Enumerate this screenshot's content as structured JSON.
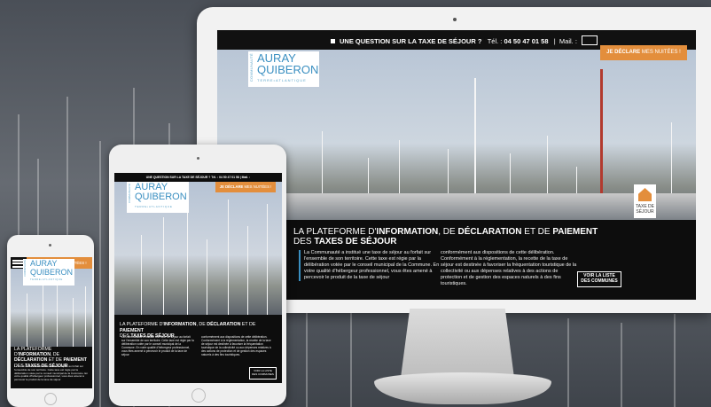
{
  "topbar": {
    "question": "UNE QUESTION SUR LA TAXE DE SÉJOUR ?",
    "tel_label": "Tél. :",
    "tel_number": "04 50 47 01 58",
    "separator": "|",
    "mail_label": "Mail. :"
  },
  "logo": {
    "vertical": "COMMUNAUTÉ",
    "line1": "AURAY",
    "line2": "QUIBERON",
    "tagline": "TERRE•ATLANTIQUE"
  },
  "cta": {
    "strong": "JE DÉCLARE",
    "rest": "MES NUITÉES !"
  },
  "badge": {
    "line1": "TAXE DE",
    "line2": "SÉJOUR"
  },
  "hero": {
    "title_part1": "LA PLATEFORME D'",
    "title_bold1": "INFORMATION",
    "title_part2": ", DE ",
    "title_bold2": "DÉCLARATION",
    "title_part3": " ET DE ",
    "title_bold3": "PAIEMENT",
    "title_part4": "DES ",
    "title_bold4": "TAXES DE SÉJOUR",
    "col1": "La Communauté a institué une taxe de séjour au forfait sur l'ensemble de son territoire. Cette taxe est régie par la délibération votée par le conseil municipal de la Commune. En votre qualité d'hébergeur professionnel, vous êtes amené à percevoir le produit de la taxe de séjour",
    "col2": "conformément aux dispositions de cette délibération. Conformément à la réglementation, la recette de la taxe de séjour est destinée à favoriser la fréquentation touristique de la collectivité ou aux dépenses relatives à des actions de protection et de gestion des espaces naturels à des fins touristiques.",
    "list_button_line1": "VOIR LA LISTE",
    "list_button_line2": "DES COMMUNES"
  },
  "colors": {
    "accent_orange": "#e38e3c",
    "brand_blue": "#3a8fc1",
    "header_black": "#111111"
  },
  "icons": [
    "mail-icon",
    "menu-icon",
    "house-icon"
  ]
}
